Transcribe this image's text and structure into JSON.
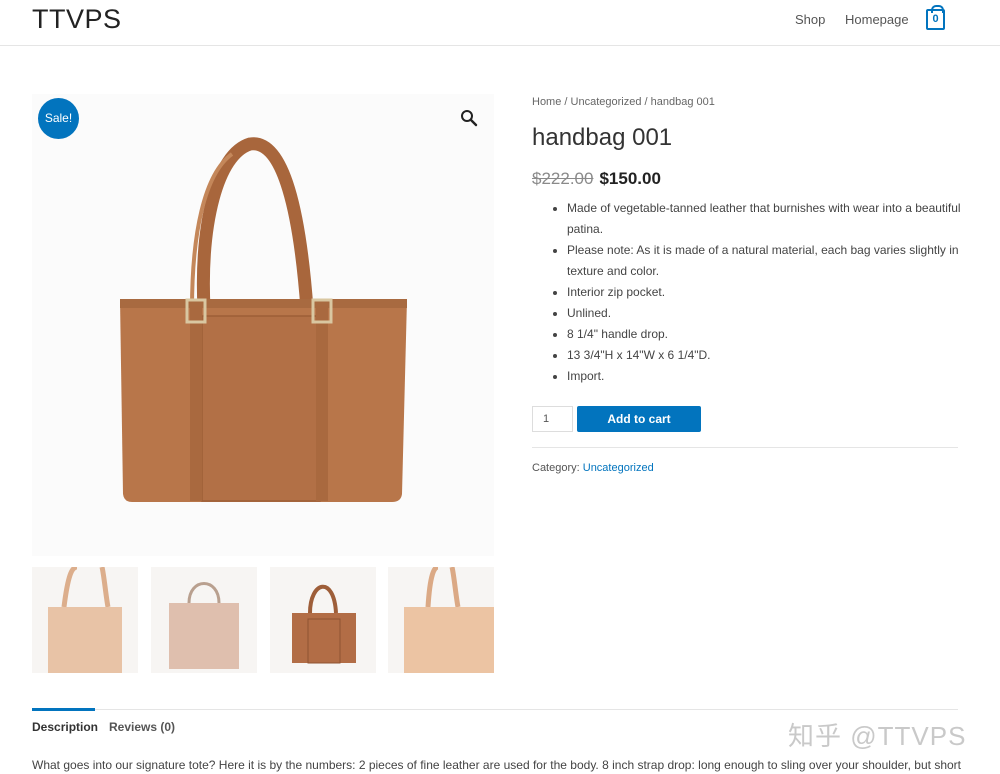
{
  "header": {
    "logo": "TTVPS",
    "nav": {
      "shop": "Shop",
      "homepage": "Homepage"
    },
    "cart_count": "0"
  },
  "gallery": {
    "sale_badge": "Sale!",
    "zoom_icon": "search-icon",
    "product_color": "#b8764a",
    "thumbnail_colors": [
      "#e8c3a6",
      "#dfbfae",
      "#b26d46",
      "#ecc4a3"
    ]
  },
  "breadcrumb": {
    "home": "Home",
    "sep1": " / ",
    "category": "Uncategorized",
    "sep2": " / handbag 001"
  },
  "product": {
    "title": "handbag 001",
    "old_price": "$222.00",
    "new_price": "$150.00",
    "bullets": [
      "Made of vegetable-tanned leather that burnishes with wear into a beautiful patina.",
      "Please note: As it is made of a natural material, each bag varies slightly in texture and color.",
      "Interior zip pocket.",
      "Unlined.",
      "8 1/4\" handle drop.",
      "13 3/4\"H x 14\"W x 6 1/4\"D.",
      "Import."
    ],
    "quantity": "1",
    "add_to_cart": "Add to cart",
    "category_label": "Category: ",
    "category_value": "Uncategorized"
  },
  "tabs": {
    "description": "Description",
    "reviews": "Reviews (0)"
  },
  "description_text": "What goes into our signature tote? Here it is by the numbers: 2 pieces of fine leather are used for the body. 8 inch strap drop: long enough to sling over your shoulder, but short",
  "watermark": "知乎 @TTVPS",
  "colors": {
    "accent": "#0274be"
  }
}
